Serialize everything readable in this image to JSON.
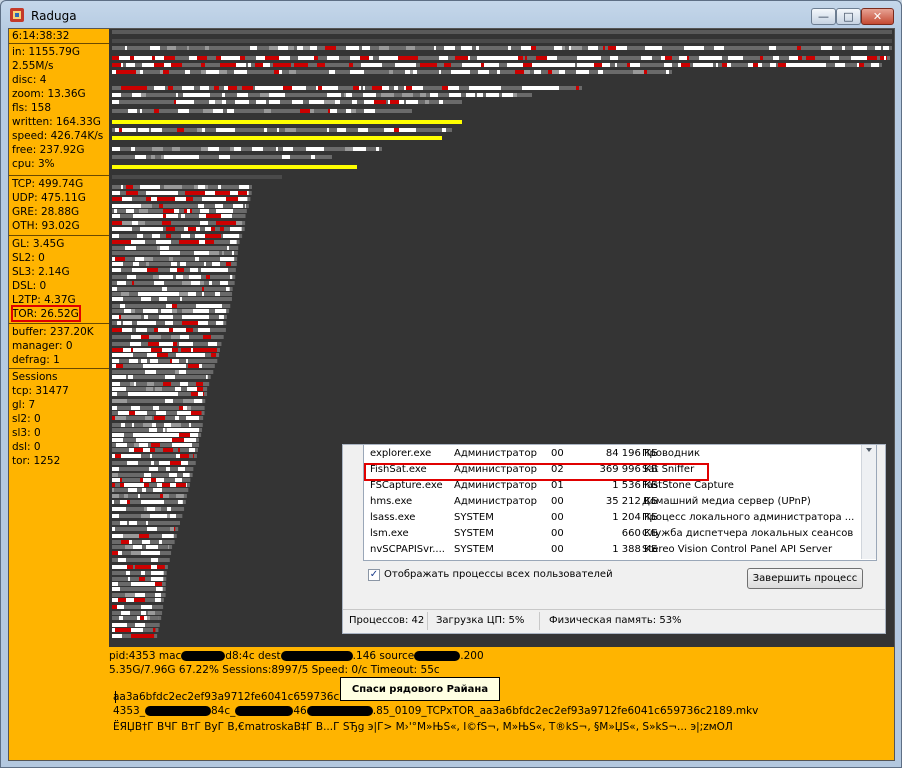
{
  "window": {
    "title": "Raduga"
  },
  "stats": {
    "time": "6:14:38:32",
    "group1": [
      "in: 1155.79G",
      "2.55M/s",
      "disc: 4",
      "zoom: 13.36G",
      "fls: 158",
      "written: 164.33G",
      "speed: 426.74K/s",
      "free: 237.92G",
      "cpu: 3%"
    ],
    "group2": [
      "TCP: 499.74G",
      "UDP: 475.11G",
      "GRE: 28.88G",
      "OTH: 93.02G"
    ],
    "group3": [
      "GL: 3.45G",
      "SL2: 0",
      "SL3: 2.14G",
      "DSL: 0",
      "L2TP: 4.37G",
      "TOR: 26.52G"
    ],
    "group4": [
      "buffer: 237.20K",
      "manager: 0",
      "defrag: 1"
    ],
    "group5": [
      "Sessions",
      "tcp: 31477",
      "gl: 7",
      "sl2: 0",
      "sl3: 0",
      "dsl: 0",
      "tor: 1252"
    ]
  },
  "task_manager": {
    "processes": [
      {
        "name": "explorer.exe",
        "user": "Администратор",
        "cpu": "00",
        "mem": "84 196 КБ",
        "desc": "Проводник"
      },
      {
        "name": "FishSat.exe",
        "user": "Администратор",
        "cpu": "02",
        "mem": "369 996 КБ",
        "desc": "Sat Sniffer"
      },
      {
        "name": "FSCapture.exe",
        "user": "Администратор",
        "cpu": "01",
        "mem": "1 536 КБ",
        "desc": "FastStone Capture"
      },
      {
        "name": "hms.exe",
        "user": "Администратор",
        "cpu": "00",
        "mem": "35 212 КБ",
        "desc": "Домашний медиа сервер (UPnP)"
      },
      {
        "name": "lsass.exe",
        "user": "SYSTEM",
        "cpu": "00",
        "mem": "1 204 КБ",
        "desc": "Процесс локального администратора ..."
      },
      {
        "name": "lsm.exe",
        "user": "SYSTEM",
        "cpu": "00",
        "mem": "660 КБ",
        "desc": "Служба диспетчера локальных сеансов"
      },
      {
        "name": "nvSCPAPISvr....",
        "user": "SYSTEM",
        "cpu": "00",
        "mem": "1 388 КБ",
        "desc": "Stereo Vision Control Panel API Server"
      }
    ],
    "show_all_label": "Отображать процессы всех пользователей",
    "end_process_label": "Завершить процесс",
    "status": {
      "processes": "Процессов: 42",
      "cpu": "Загрузка ЦП: 5%",
      "memory": "Физическая память: 53%"
    }
  },
  "session": {
    "pid_prefix": "pid:4353  mac",
    "pid_mid1": "d8:4c  dest",
    "pid_mid2": ".146  source",
    "pid_end": ".200",
    "line2": "5.35G/7.96G  67.22%  Sessions:8997/5  Speed: 0/c  Timeout: 55c",
    "hash": "aa3a6bfdc2ec2ef93a9712fe6041c659736c2189",
    "file_prefix": "4353_",
    "file_mid1": "84c_",
    "file_mid2": "46",
    "file_end": ".85_0109_TCPxTOR_aa3a6bfdc2ec2ef93a9712fe6041c659736c2189.mkv",
    "garbled": "ЁЯЏВ†Г ВЧГ ВтГ ВуГ В,€matroskaВ‡Г В...Г  ЅЂg    э|Г> М›'°М»ЊЅ«, І©fЅ¬,  М»ЊЅ«, Т®kЅ¬, §М»ЏЅ«, Ѕ»kЅ¬... э|;zмОЛ",
    "tooltip": "Спаси рядового Райана"
  }
}
